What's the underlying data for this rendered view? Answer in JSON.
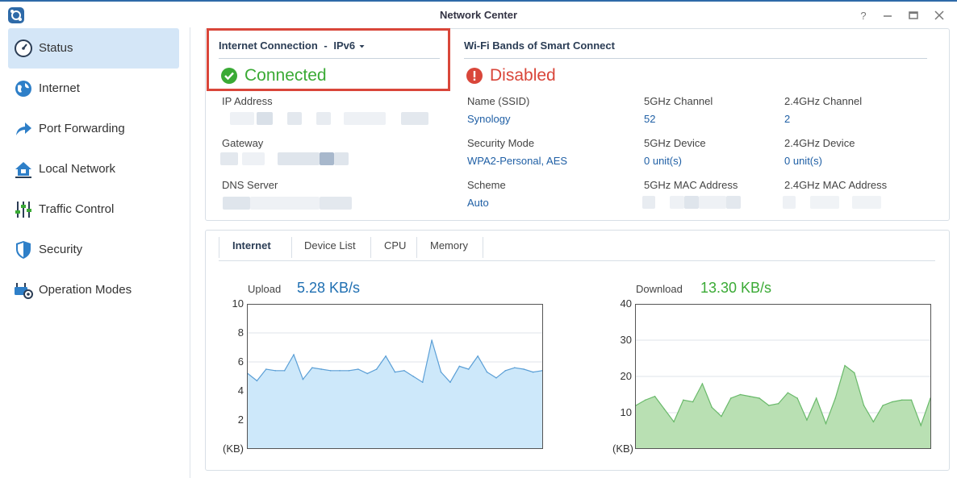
{
  "window": {
    "title": "Network Center",
    "controls": [
      "help-icon",
      "minimize-icon",
      "maximize-icon",
      "close-icon"
    ]
  },
  "sidebar": {
    "items": [
      {
        "label": "Status",
        "icon": "gauge-icon",
        "active": true
      },
      {
        "label": "Internet",
        "icon": "globe-icon"
      },
      {
        "label": "Port Forwarding",
        "icon": "forward-arrow-icon"
      },
      {
        "label": "Local Network",
        "icon": "home-network-icon"
      },
      {
        "label": "Traffic Control",
        "icon": "sliders-icon"
      },
      {
        "label": "Security",
        "icon": "shield-icon"
      },
      {
        "label": "Operation Modes",
        "icon": "router-gear-icon"
      }
    ]
  },
  "internet_connection": {
    "title": "Internet Connection",
    "separator": "-",
    "protocol": "IPv6",
    "status": "Connected",
    "status_color": "#3aaa35",
    "fields": [
      {
        "label": "IP Address"
      },
      {
        "label": "Gateway"
      },
      {
        "label": "DNS Server"
      }
    ]
  },
  "wifi": {
    "title": "Wi-Fi Bands of Smart Connect",
    "status": "Disabled",
    "status_color": "#d9463a",
    "fields": [
      {
        "label": "Name (SSID)",
        "value": "Synology"
      },
      {
        "label": "5GHz Channel",
        "value": "52"
      },
      {
        "label": "2.4GHz Channel",
        "value": "2"
      },
      {
        "label": "Security Mode",
        "value": "WPA2-Personal, AES"
      },
      {
        "label": "5GHz Device",
        "value": "0 unit(s)"
      },
      {
        "label": "2.4GHz Device",
        "value": "0 unit(s)"
      },
      {
        "label": "Scheme",
        "value": "Auto"
      },
      {
        "label": "5GHz MAC Address"
      },
      {
        "label": "2.4GHz MAC Address"
      }
    ]
  },
  "tabs": [
    {
      "label": "Internet",
      "active": true
    },
    {
      "label": "Device List"
    },
    {
      "label": "CPU"
    },
    {
      "label": "Memory"
    }
  ],
  "chart_data": [
    {
      "type": "area",
      "title": "Upload",
      "current_value": "5.28 KB/s",
      "value_color": "#1f6fb2",
      "fill_color": "#cde8fa",
      "line_color": "#5b9fd6",
      "ylabel": "(KB)",
      "yticks": [
        "10",
        "8",
        "6",
        "4",
        "2"
      ],
      "ylim": [
        0,
        10
      ],
      "values": [
        5.2,
        4.7,
        5.5,
        5.4,
        5.4,
        6.5,
        4.8,
        5.6,
        5.5,
        5.4,
        5.4,
        5.4,
        5.5,
        5.2,
        5.5,
        6.4,
        5.3,
        5.4,
        5.0,
        4.6,
        7.5,
        5.3,
        4.6,
        5.7,
        5.5,
        6.4,
        5.3,
        4.9,
        5.4,
        5.6,
        5.5,
        5.3,
        5.4
      ]
    },
    {
      "type": "area",
      "title": "Download",
      "current_value": "13.30 KB/s",
      "value_color": "#3aaa35",
      "fill_color": "#b9e0b3",
      "line_color": "#69b96a",
      "ylabel": "(KB)",
      "yticks": [
        "40",
        "30",
        "20",
        "10"
      ],
      "ylim": [
        0,
        40
      ],
      "values": [
        12,
        13.5,
        14.5,
        11,
        7.5,
        13.5,
        13,
        18,
        11.5,
        9,
        14,
        15,
        14.5,
        14,
        12,
        12.5,
        15.5,
        14,
        8,
        14,
        7,
        14,
        23,
        21,
        12,
        7.5,
        12,
        13,
        13.5,
        13.5,
        6.5,
        14
      ]
    }
  ]
}
